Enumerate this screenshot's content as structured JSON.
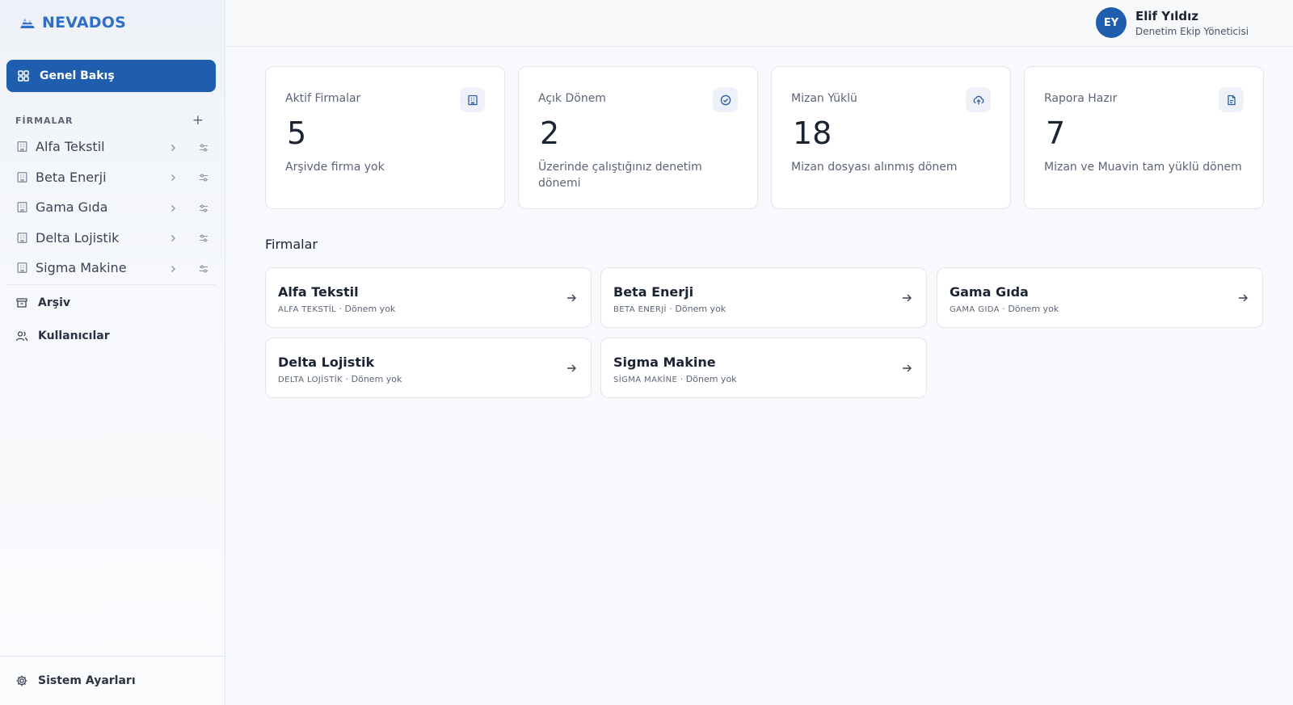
{
  "brand": {
    "name": "NEVADOS",
    "color": "#2f6fc6"
  },
  "sidebar": {
    "active_item": {
      "label": "Genel Bakış",
      "icon": "grid-icon"
    },
    "section_title": "FİRMALAR",
    "add_icon": "plus-icon",
    "firms": [
      {
        "label": "Alfa Tekstil"
      },
      {
        "label": "Beta Enerji"
      },
      {
        "label": "Gama Gıda"
      },
      {
        "label": "Delta Lojistik"
      },
      {
        "label": "Sigma Makine"
      }
    ],
    "archive_label": "Arşiv",
    "users_label": "Kullanıcılar",
    "settings_label": "Sistem Ayarları"
  },
  "user": {
    "initials": "EY",
    "name": "Elif Yıldız",
    "role": "Denetim Ekip Yöneticisi"
  },
  "stats": [
    {
      "title": "Aktif Firmalar",
      "value": "5",
      "desc": "Arşivde firma yok",
      "icon": "building-icon"
    },
    {
      "title": "Açık Dönem",
      "value": "2",
      "desc": "Üzerinde çalıştığınız denetim dönemi",
      "icon": "check-circle-icon"
    },
    {
      "title": "Mizan Yüklü",
      "value": "18",
      "desc": "Mizan dosyası alınmış dönem",
      "icon": "cloud-upload-icon"
    },
    {
      "title": "Rapora Hazır",
      "value": "7",
      "desc": "Mizan ve Muavin tam yüklü dönem",
      "icon": "document-icon"
    }
  ],
  "firms_section": {
    "title": "Firmalar",
    "cards": [
      {
        "name": "Alfa Tekstil",
        "code": "ALFA TEKSTİL",
        "status": "Dönem yok"
      },
      {
        "name": "Beta Enerji",
        "code": "BETA ENERJİ",
        "status": "Dönem yok"
      },
      {
        "name": "Gama Gıda",
        "code": "GAMA GIDA",
        "status": "Dönem yok"
      },
      {
        "name": "Delta Lojistik",
        "code": "DELTA LOJİSTİK",
        "status": "Dönem yok"
      },
      {
        "name": "Sigma Makine",
        "code": "SİGMA MAKİNE",
        "status": "Dönem yok"
      }
    ]
  },
  "colors": {
    "accent": "#1f5eae",
    "border": "#e2e6ec",
    "muted": "#5b6577"
  }
}
